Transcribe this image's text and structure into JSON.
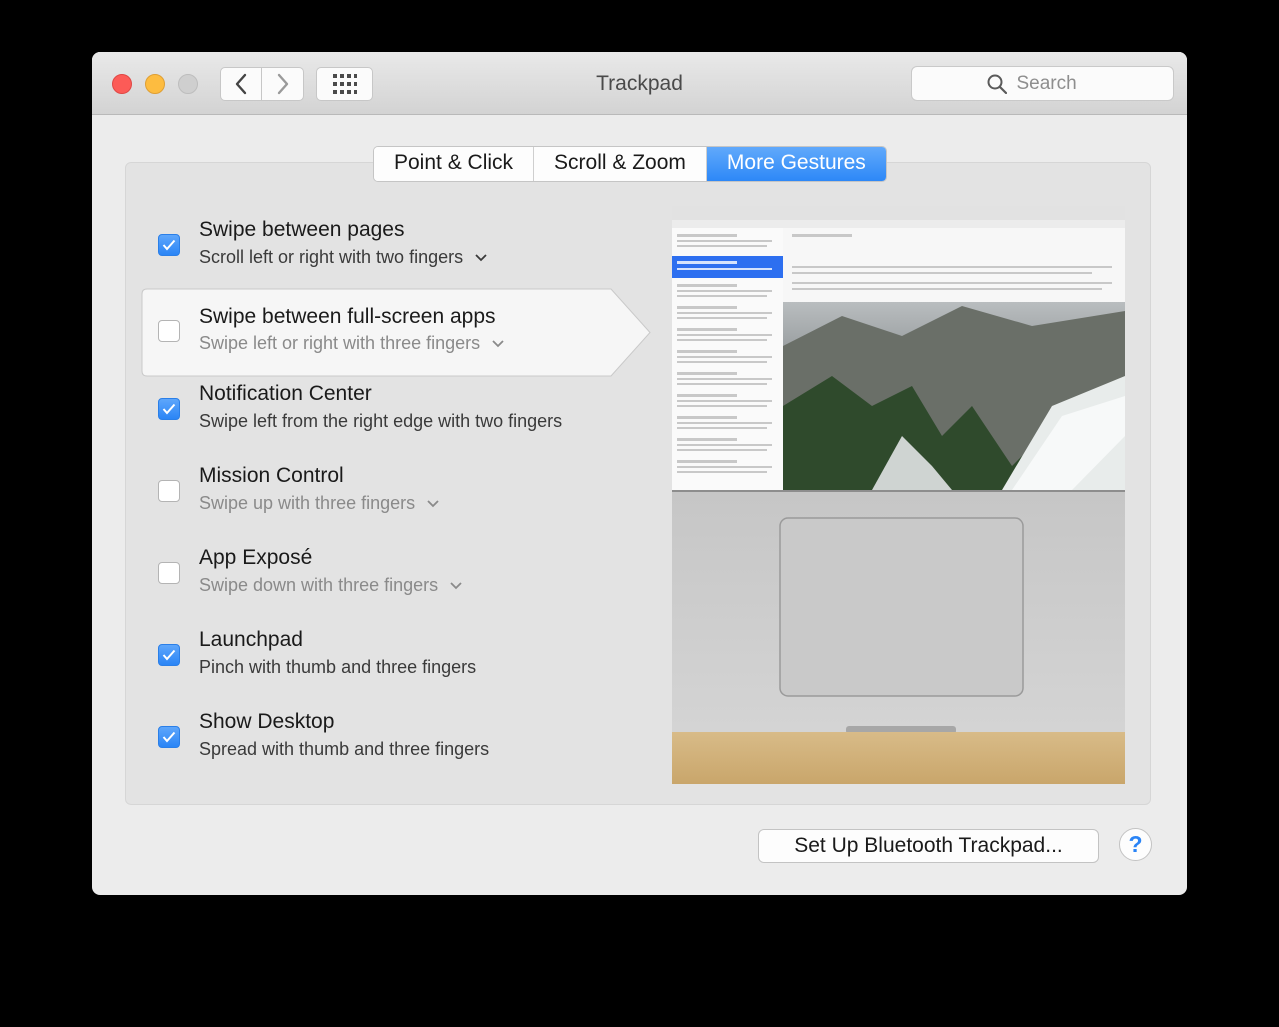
{
  "window": {
    "title": "Trackpad"
  },
  "toolbar": {
    "back_icon": "chevron-left-icon",
    "forward_icon": "chevron-right-icon",
    "grid_icon": "grid-icon",
    "search_placeholder": "Search"
  },
  "tabs": [
    {
      "label": "Point & Click",
      "active": false
    },
    {
      "label": "Scroll & Zoom",
      "active": false
    },
    {
      "label": "More Gestures",
      "active": true
    }
  ],
  "gestures": [
    {
      "title": "Swipe between pages",
      "subtitle": "Scroll left or right with two fingers",
      "checked": true,
      "has_menu": true
    },
    {
      "title": "Swipe between full-screen apps",
      "subtitle": "Swipe left or right with three fingers",
      "checked": false,
      "has_menu": true,
      "selected": true
    },
    {
      "title": "Notification Center",
      "subtitle": "Swipe left from the right edge with two fingers",
      "checked": true,
      "has_menu": false
    },
    {
      "title": "Mission Control",
      "subtitle": "Swipe up with three fingers",
      "checked": false,
      "has_menu": true
    },
    {
      "title": "App Exposé",
      "subtitle": "Swipe down with three fingers",
      "checked": false,
      "has_menu": true
    },
    {
      "title": "Launchpad",
      "subtitle": "Pinch with thumb and three fingers",
      "checked": true,
      "has_menu": false
    },
    {
      "title": "Show Desktop",
      "subtitle": "Spread with thumb and three fingers",
      "checked": true,
      "has_menu": false
    }
  ],
  "footer": {
    "setup_button": "Set Up Bluetooth Trackpad...",
    "help_label": "?"
  },
  "colors": {
    "accent": "#2d88f7",
    "close": "#fc5b57",
    "minimize": "#fdbc40",
    "zoom": "#cfcfcf"
  }
}
